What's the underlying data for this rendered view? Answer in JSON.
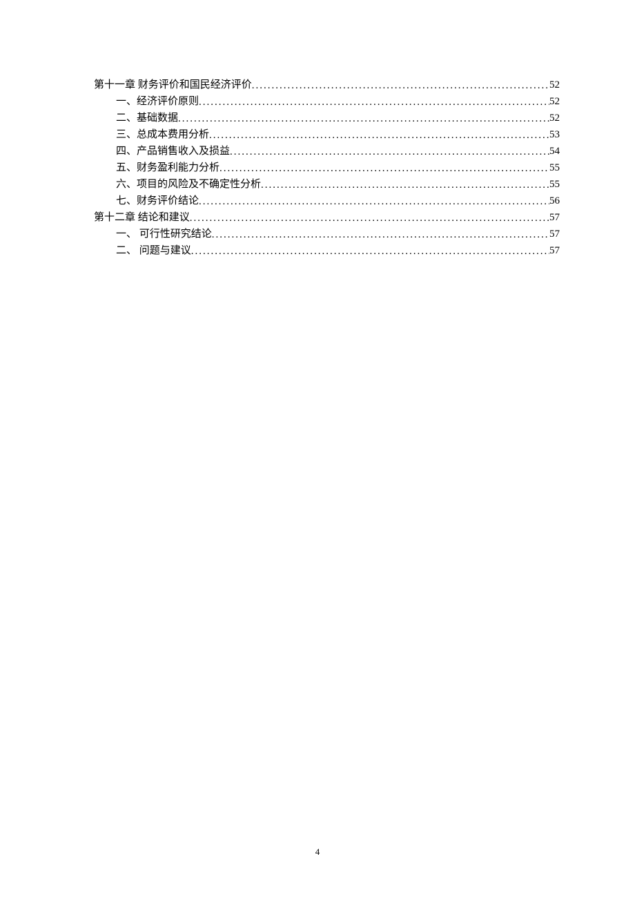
{
  "toc": [
    {
      "level": 1,
      "label": "第十一章 财务评价和国民经济评价",
      "page": "52"
    },
    {
      "level": 2,
      "label": "一、经济评价原则",
      "page": "52"
    },
    {
      "level": 2,
      "label": "二、基础数据",
      "page": "52"
    },
    {
      "level": 2,
      "label": "三、总成本费用分析",
      "page": "53"
    },
    {
      "level": 2,
      "label": "四、产品销售收入及损益",
      "page": "54"
    },
    {
      "level": 2,
      "label": "五、财务盈利能力分析",
      "page": "55"
    },
    {
      "level": 2,
      "label": "六、项目的风险及不确定性分析",
      "page": "55"
    },
    {
      "level": 2,
      "label": "七、财务评价结论",
      "page": "56"
    },
    {
      "level": 1,
      "label": "第十二章 结论和建议",
      "page": "57"
    },
    {
      "level": 3,
      "label": "一、 可行性研究结论",
      "page": "57"
    },
    {
      "level": 3,
      "label": "二、 问题与建议",
      "page": "57"
    }
  ],
  "page_number": "4"
}
